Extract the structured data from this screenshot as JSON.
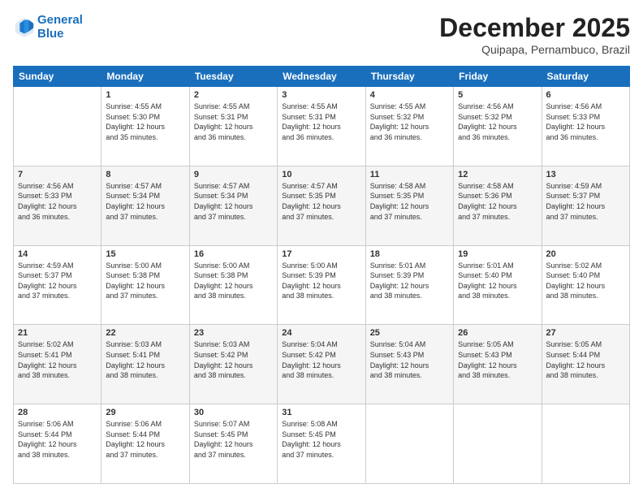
{
  "header": {
    "logo_line1": "General",
    "logo_line2": "Blue",
    "month_title": "December 2025",
    "location": "Quipapa, Pernambuco, Brazil"
  },
  "weekdays": [
    "Sunday",
    "Monday",
    "Tuesday",
    "Wednesday",
    "Thursday",
    "Friday",
    "Saturday"
  ],
  "weeks": [
    [
      {
        "day": "",
        "content": ""
      },
      {
        "day": "1",
        "content": "Sunrise: 4:55 AM\nSunset: 5:30 PM\nDaylight: 12 hours\nand 35 minutes."
      },
      {
        "day": "2",
        "content": "Sunrise: 4:55 AM\nSunset: 5:31 PM\nDaylight: 12 hours\nand 36 minutes."
      },
      {
        "day": "3",
        "content": "Sunrise: 4:55 AM\nSunset: 5:31 PM\nDaylight: 12 hours\nand 36 minutes."
      },
      {
        "day": "4",
        "content": "Sunrise: 4:55 AM\nSunset: 5:32 PM\nDaylight: 12 hours\nand 36 minutes."
      },
      {
        "day": "5",
        "content": "Sunrise: 4:56 AM\nSunset: 5:32 PM\nDaylight: 12 hours\nand 36 minutes."
      },
      {
        "day": "6",
        "content": "Sunrise: 4:56 AM\nSunset: 5:33 PM\nDaylight: 12 hours\nand 36 minutes."
      }
    ],
    [
      {
        "day": "7",
        "content": "Sunrise: 4:56 AM\nSunset: 5:33 PM\nDaylight: 12 hours\nand 36 minutes."
      },
      {
        "day": "8",
        "content": "Sunrise: 4:57 AM\nSunset: 5:34 PM\nDaylight: 12 hours\nand 37 minutes."
      },
      {
        "day": "9",
        "content": "Sunrise: 4:57 AM\nSunset: 5:34 PM\nDaylight: 12 hours\nand 37 minutes."
      },
      {
        "day": "10",
        "content": "Sunrise: 4:57 AM\nSunset: 5:35 PM\nDaylight: 12 hours\nand 37 minutes."
      },
      {
        "day": "11",
        "content": "Sunrise: 4:58 AM\nSunset: 5:35 PM\nDaylight: 12 hours\nand 37 minutes."
      },
      {
        "day": "12",
        "content": "Sunrise: 4:58 AM\nSunset: 5:36 PM\nDaylight: 12 hours\nand 37 minutes."
      },
      {
        "day": "13",
        "content": "Sunrise: 4:59 AM\nSunset: 5:37 PM\nDaylight: 12 hours\nand 37 minutes."
      }
    ],
    [
      {
        "day": "14",
        "content": "Sunrise: 4:59 AM\nSunset: 5:37 PM\nDaylight: 12 hours\nand 37 minutes."
      },
      {
        "day": "15",
        "content": "Sunrise: 5:00 AM\nSunset: 5:38 PM\nDaylight: 12 hours\nand 37 minutes."
      },
      {
        "day": "16",
        "content": "Sunrise: 5:00 AM\nSunset: 5:38 PM\nDaylight: 12 hours\nand 38 minutes."
      },
      {
        "day": "17",
        "content": "Sunrise: 5:00 AM\nSunset: 5:39 PM\nDaylight: 12 hours\nand 38 minutes."
      },
      {
        "day": "18",
        "content": "Sunrise: 5:01 AM\nSunset: 5:39 PM\nDaylight: 12 hours\nand 38 minutes."
      },
      {
        "day": "19",
        "content": "Sunrise: 5:01 AM\nSunset: 5:40 PM\nDaylight: 12 hours\nand 38 minutes."
      },
      {
        "day": "20",
        "content": "Sunrise: 5:02 AM\nSunset: 5:40 PM\nDaylight: 12 hours\nand 38 minutes."
      }
    ],
    [
      {
        "day": "21",
        "content": "Sunrise: 5:02 AM\nSunset: 5:41 PM\nDaylight: 12 hours\nand 38 minutes."
      },
      {
        "day": "22",
        "content": "Sunrise: 5:03 AM\nSunset: 5:41 PM\nDaylight: 12 hours\nand 38 minutes."
      },
      {
        "day": "23",
        "content": "Sunrise: 5:03 AM\nSunset: 5:42 PM\nDaylight: 12 hours\nand 38 minutes."
      },
      {
        "day": "24",
        "content": "Sunrise: 5:04 AM\nSunset: 5:42 PM\nDaylight: 12 hours\nand 38 minutes."
      },
      {
        "day": "25",
        "content": "Sunrise: 5:04 AM\nSunset: 5:43 PM\nDaylight: 12 hours\nand 38 minutes."
      },
      {
        "day": "26",
        "content": "Sunrise: 5:05 AM\nSunset: 5:43 PM\nDaylight: 12 hours\nand 38 minutes."
      },
      {
        "day": "27",
        "content": "Sunrise: 5:05 AM\nSunset: 5:44 PM\nDaylight: 12 hours\nand 38 minutes."
      }
    ],
    [
      {
        "day": "28",
        "content": "Sunrise: 5:06 AM\nSunset: 5:44 PM\nDaylight: 12 hours\nand 38 minutes."
      },
      {
        "day": "29",
        "content": "Sunrise: 5:06 AM\nSunset: 5:44 PM\nDaylight: 12 hours\nand 37 minutes."
      },
      {
        "day": "30",
        "content": "Sunrise: 5:07 AM\nSunset: 5:45 PM\nDaylight: 12 hours\nand 37 minutes."
      },
      {
        "day": "31",
        "content": "Sunrise: 5:08 AM\nSunset: 5:45 PM\nDaylight: 12 hours\nand 37 minutes."
      },
      {
        "day": "",
        "content": ""
      },
      {
        "day": "",
        "content": ""
      },
      {
        "day": "",
        "content": ""
      }
    ]
  ]
}
